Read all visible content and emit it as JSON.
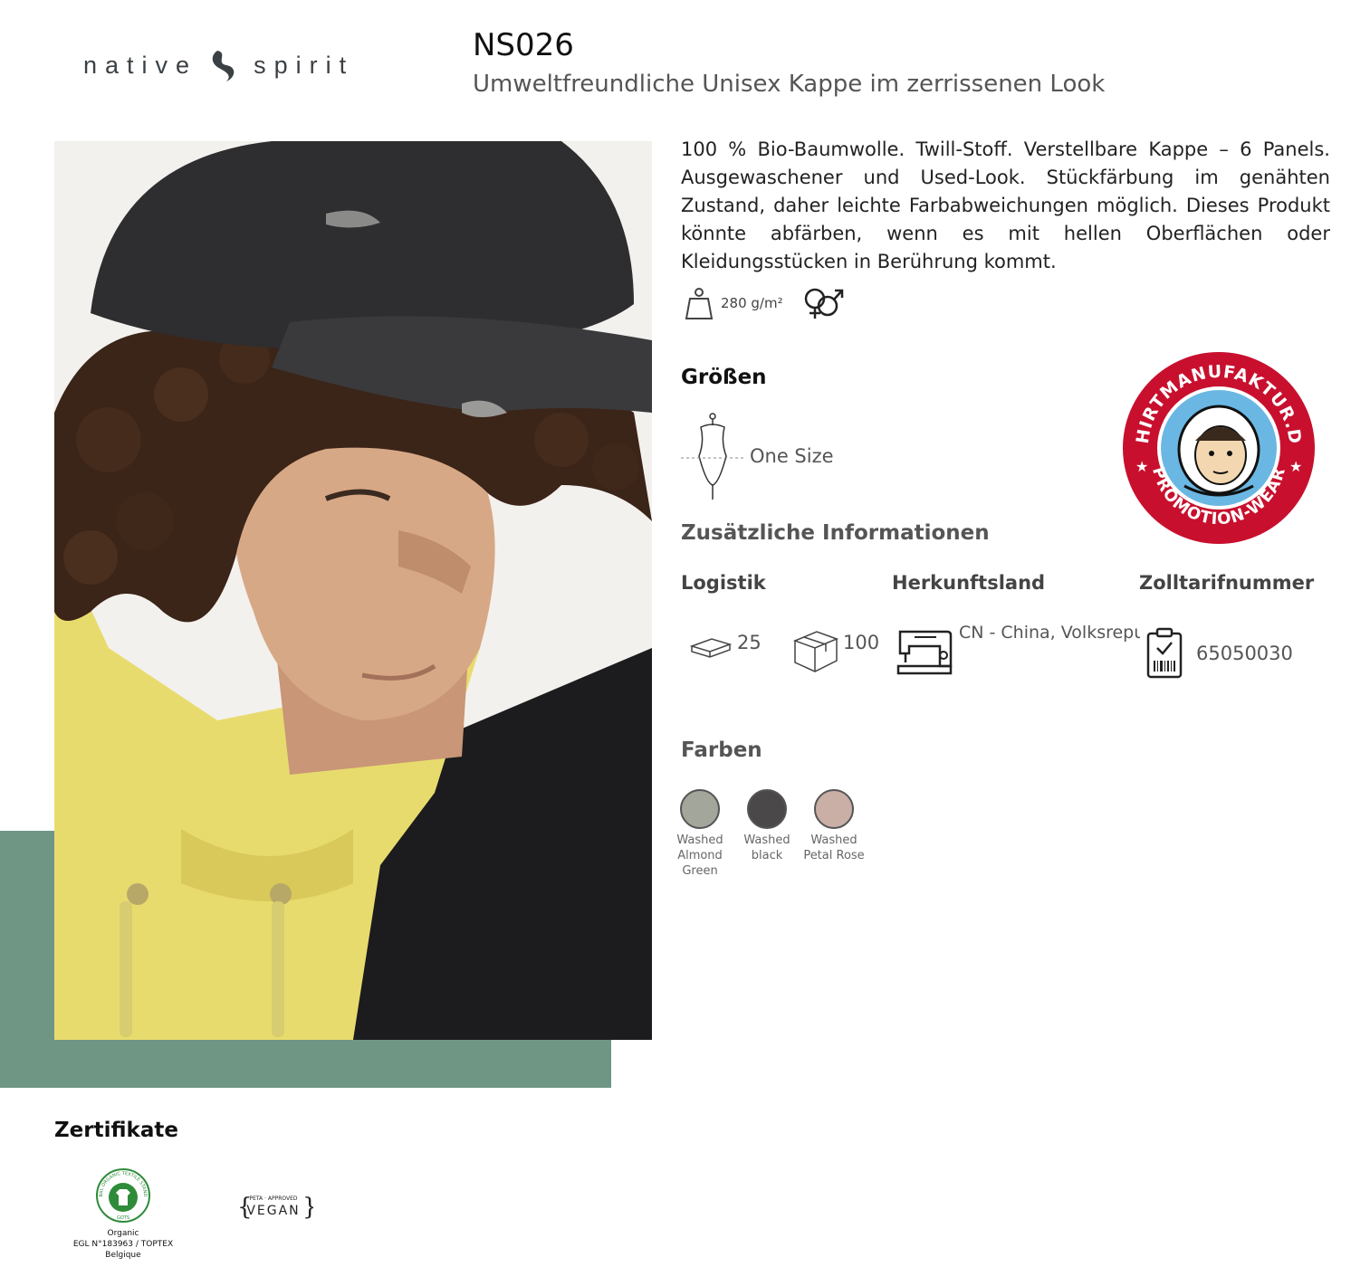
{
  "brand": {
    "left": "native",
    "right": "spirit"
  },
  "product": {
    "sku": "NS026",
    "title": "Umweltfreundliche Unisex Kappe im zerrissenen Look",
    "description": "100 % Bio-Baumwolle. Twill-Stoff. Verstellbare Kappe – 6 Panels. Ausgewaschener und Used-Look. Stückfärbung im genähten Zustand, daher leichte Farbabweichungen möglich. Dieses Produkt könnte abfärben, wenn es mit hellen Oberflächen oder Kleidungsstücken in Berührung kommt.",
    "weight": "280 g/m²"
  },
  "sizes": {
    "title": "Größen",
    "value": "One Size"
  },
  "additional": {
    "title": "Zusätzliche Informationen",
    "logistics_label": "Logistik",
    "pack_qty": "25",
    "carton_qty": "100",
    "origin_label": "Herkunftsland",
    "origin_value": "CN - China, Volksrepublik",
    "tariff_label": "Zolltarifnummer",
    "tariff_value": "65050030"
  },
  "colors": {
    "title": "Farben",
    "items": [
      {
        "name": "Washed Almond Green",
        "hex": "#a3a69a"
      },
      {
        "name": "Washed black",
        "hex": "#4a4848"
      },
      {
        "name": "Washed Petal Rose",
        "hex": "#c9afa6"
      }
    ]
  },
  "badge": {
    "top_text": "SHIRTMANUFAKTUR.DE",
    "bottom_text": "PROMOTION-WEAR"
  },
  "certificates": {
    "title": "Zertifikate",
    "gots_ring": "GLOBAL ORGANIC TEXTILE STANDARD",
    "gots_abbr": "GOTS",
    "gots_line1": "Organic",
    "gots_line2": "EGL N°183963 / TOPTEX Belgique",
    "vegan_small": "PETA · APPROVED",
    "vegan_label": "VEGAN"
  },
  "theme": {
    "accent_green": "#6f9585",
    "badge_red": "#c8102e",
    "badge_blue": "#6ab7e3"
  }
}
